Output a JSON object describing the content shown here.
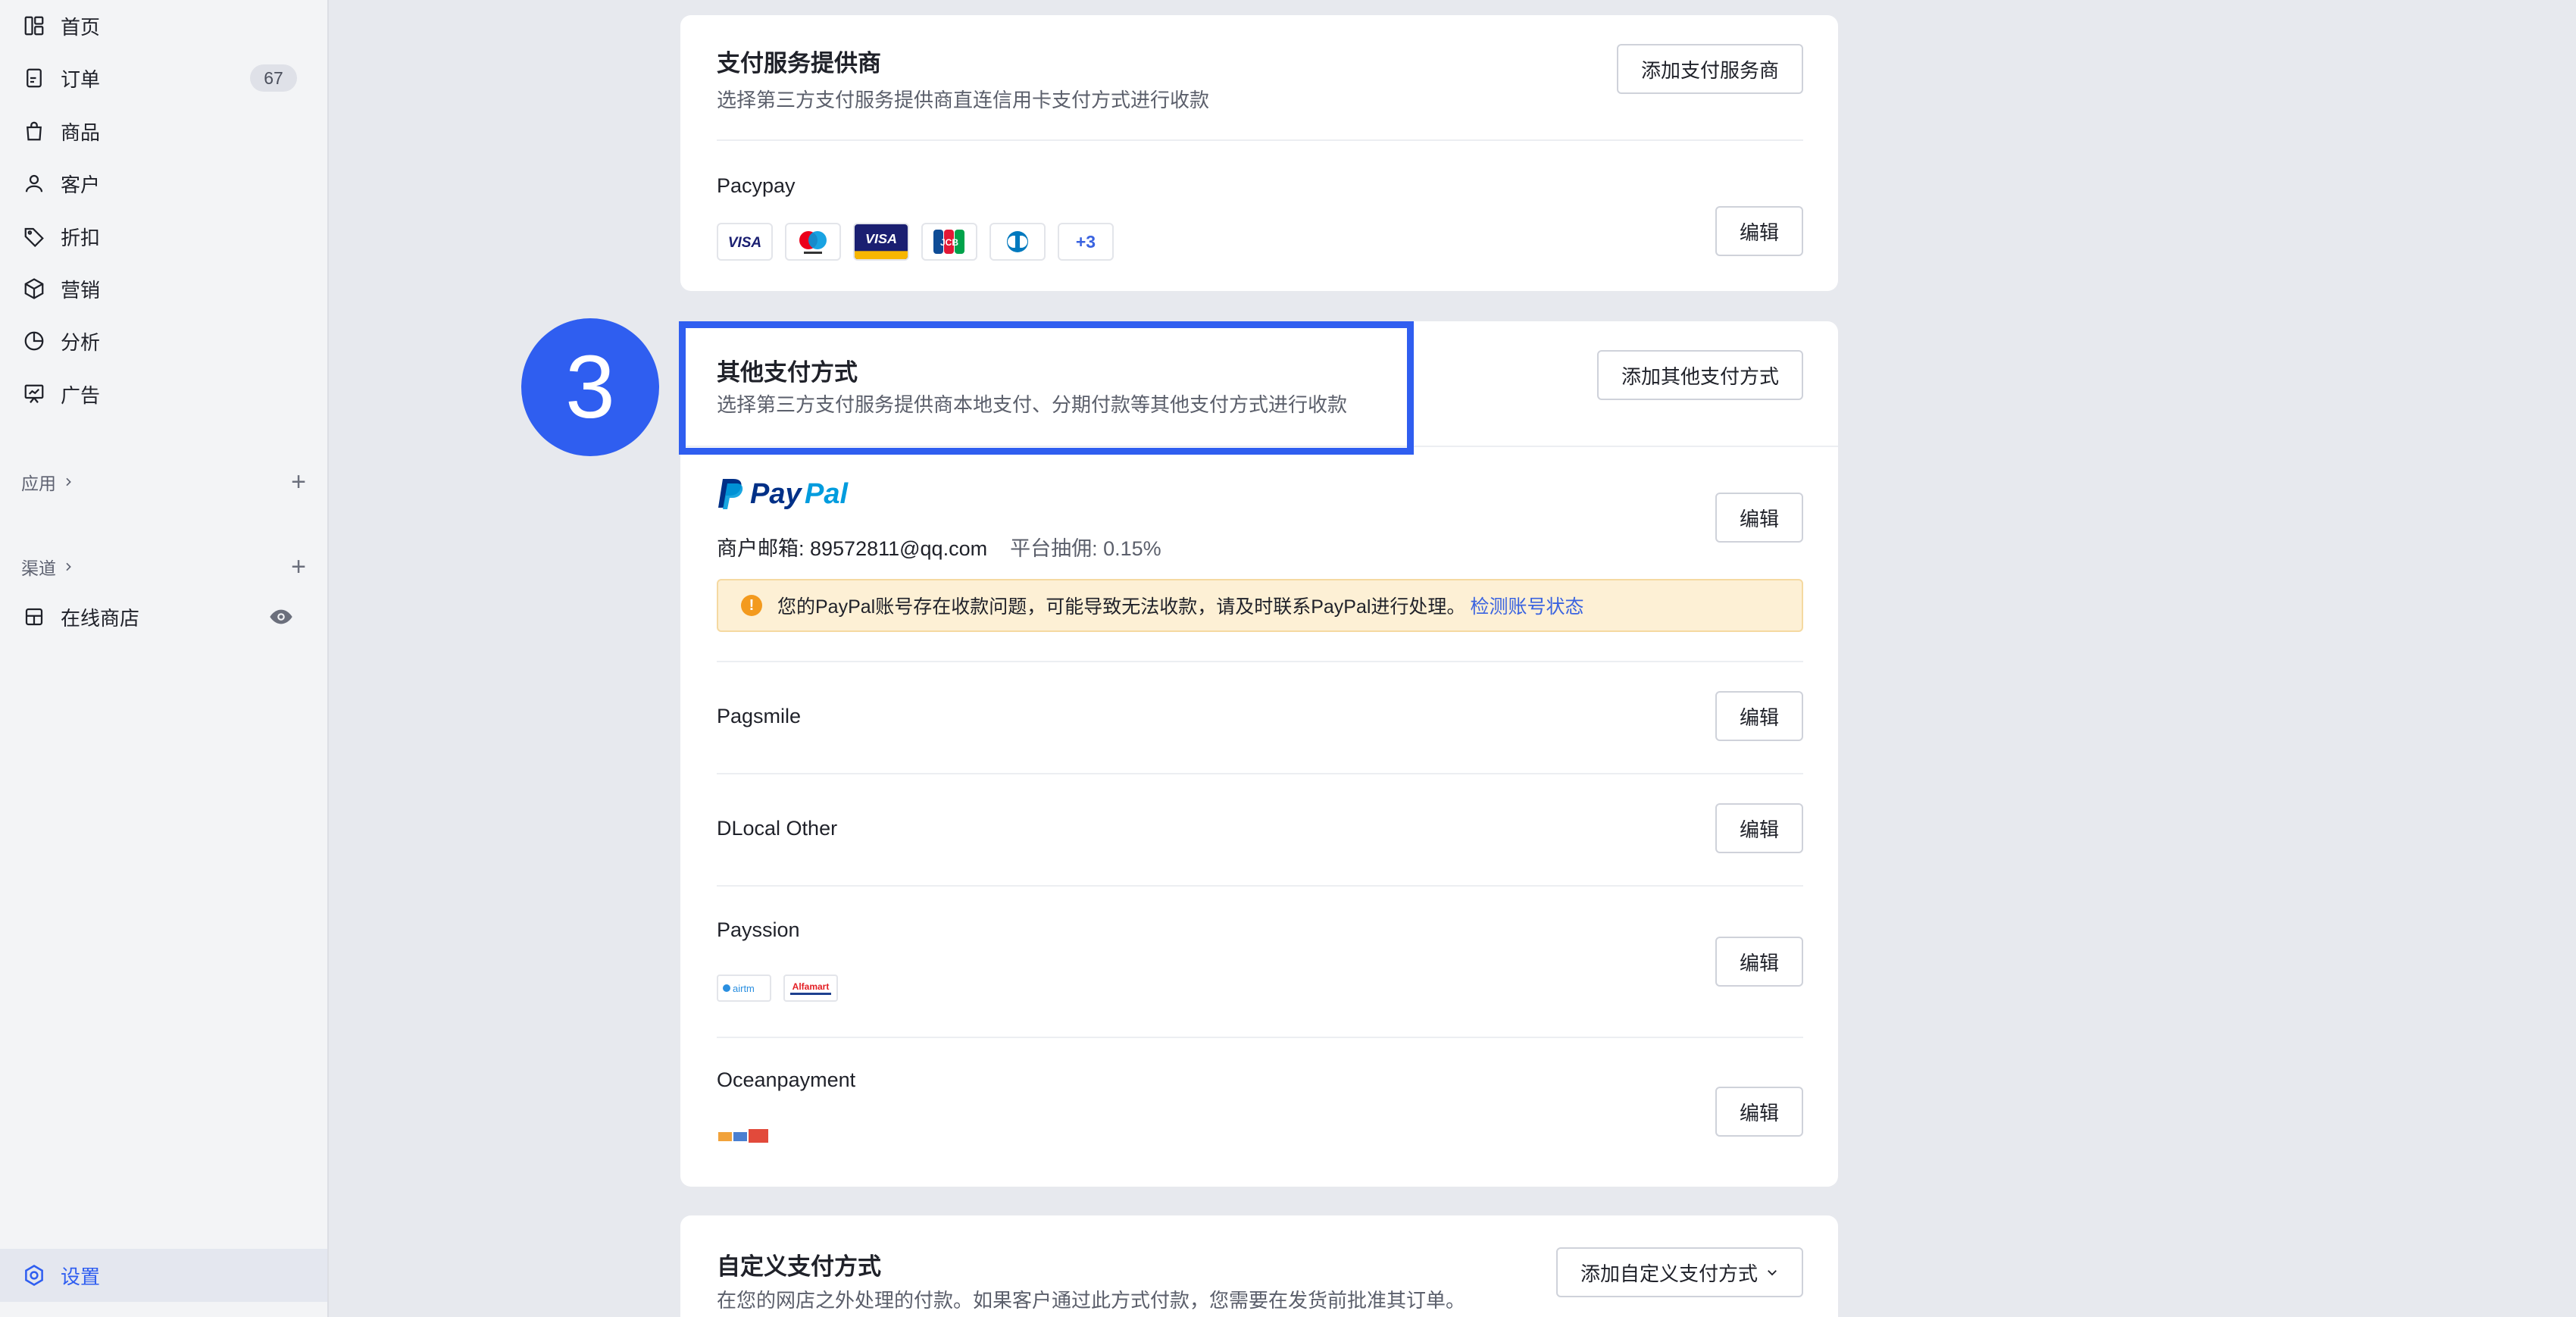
{
  "sidebar": {
    "items": [
      {
        "label": "首页",
        "icon": "dashboard-icon"
      },
      {
        "label": "订单",
        "icon": "order-icon",
        "badge": "67"
      },
      {
        "label": "商品",
        "icon": "bag-icon"
      },
      {
        "label": "客户",
        "icon": "user-icon"
      },
      {
        "label": "折扣",
        "icon": "tag-icon"
      },
      {
        "label": "营销",
        "icon": "cube-icon"
      },
      {
        "label": "分析",
        "icon": "pie-icon"
      },
      {
        "label": "广告",
        "icon": "board-icon"
      }
    ],
    "apps_label": "应用",
    "channels_label": "渠道",
    "online_store_label": "在线商店",
    "settings_label": "设置"
  },
  "providers": {
    "title": "支付服务提供商",
    "desc": "选择第三方支付服务提供商直连信用卡支付方式进行收款",
    "add_button": "添加支付服务商",
    "pacypay": {
      "name": "Pacypay",
      "edit": "编辑",
      "more_count": "+3"
    }
  },
  "step": {
    "number": "3"
  },
  "other": {
    "title": "其他支付方式",
    "desc": "选择第三方支付服务提供商本地支付、分期付款等其他支付方式进行收款",
    "add_button": "添加其他支付方式",
    "paypal": {
      "merchant": "商户邮箱: 89572811@qq.com",
      "fee": "平台抽佣:   0.15%",
      "warning": "您的PayPal账号存在收款问题，可能导致无法收款，请及时联系PayPal进行处理。",
      "warning_link": "检测账号状态",
      "edit": "编辑"
    },
    "rows": [
      {
        "name": "Pagsmile",
        "edit": "编辑"
      },
      {
        "name": "DLocal Other",
        "edit": "编辑"
      },
      {
        "name": "Payssion",
        "edit": "编辑"
      },
      {
        "name": "Oceanpayment",
        "edit": "编辑"
      }
    ]
  },
  "custom": {
    "title": "自定义支付方式",
    "desc": "在您的网店之外处理的付款。如果客户通过此方式付款，您需要在发货前批准其订单。",
    "add_button": "添加自定义支付方式"
  },
  "colors": {
    "accent": "#2f5ef0",
    "warning_bg": "#fdf0d5",
    "link": "#3a63e0",
    "paypal_dark": "#003087",
    "paypal_light": "#009cde"
  }
}
